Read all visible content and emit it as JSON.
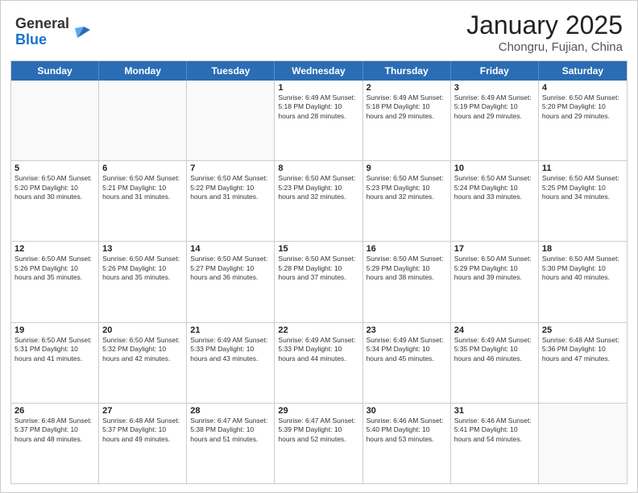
{
  "header": {
    "logo_line1": "General",
    "logo_line2": "Blue",
    "month": "January 2025",
    "location": "Chongru, Fujian, China"
  },
  "day_headers": [
    "Sunday",
    "Monday",
    "Tuesday",
    "Wednesday",
    "Thursday",
    "Friday",
    "Saturday"
  ],
  "weeks": [
    [
      {
        "day": "",
        "info": ""
      },
      {
        "day": "",
        "info": ""
      },
      {
        "day": "",
        "info": ""
      },
      {
        "day": "1",
        "info": "Sunrise: 6:49 AM\nSunset: 5:18 PM\nDaylight: 10 hours\nand 28 minutes."
      },
      {
        "day": "2",
        "info": "Sunrise: 6:49 AM\nSunset: 5:18 PM\nDaylight: 10 hours\nand 29 minutes."
      },
      {
        "day": "3",
        "info": "Sunrise: 6:49 AM\nSunset: 5:19 PM\nDaylight: 10 hours\nand 29 minutes."
      },
      {
        "day": "4",
        "info": "Sunrise: 6:50 AM\nSunset: 5:20 PM\nDaylight: 10 hours\nand 29 minutes."
      }
    ],
    [
      {
        "day": "5",
        "info": "Sunrise: 6:50 AM\nSunset: 5:20 PM\nDaylight: 10 hours\nand 30 minutes."
      },
      {
        "day": "6",
        "info": "Sunrise: 6:50 AM\nSunset: 5:21 PM\nDaylight: 10 hours\nand 31 minutes."
      },
      {
        "day": "7",
        "info": "Sunrise: 6:50 AM\nSunset: 5:22 PM\nDaylight: 10 hours\nand 31 minutes."
      },
      {
        "day": "8",
        "info": "Sunrise: 6:50 AM\nSunset: 5:23 PM\nDaylight: 10 hours\nand 32 minutes."
      },
      {
        "day": "9",
        "info": "Sunrise: 6:50 AM\nSunset: 5:23 PM\nDaylight: 10 hours\nand 32 minutes."
      },
      {
        "day": "10",
        "info": "Sunrise: 6:50 AM\nSunset: 5:24 PM\nDaylight: 10 hours\nand 33 minutes."
      },
      {
        "day": "11",
        "info": "Sunrise: 6:50 AM\nSunset: 5:25 PM\nDaylight: 10 hours\nand 34 minutes."
      }
    ],
    [
      {
        "day": "12",
        "info": "Sunrise: 6:50 AM\nSunset: 5:26 PM\nDaylight: 10 hours\nand 35 minutes."
      },
      {
        "day": "13",
        "info": "Sunrise: 6:50 AM\nSunset: 5:26 PM\nDaylight: 10 hours\nand 35 minutes."
      },
      {
        "day": "14",
        "info": "Sunrise: 6:50 AM\nSunset: 5:27 PM\nDaylight: 10 hours\nand 36 minutes."
      },
      {
        "day": "15",
        "info": "Sunrise: 6:50 AM\nSunset: 5:28 PM\nDaylight: 10 hours\nand 37 minutes."
      },
      {
        "day": "16",
        "info": "Sunrise: 6:50 AM\nSunset: 5:29 PM\nDaylight: 10 hours\nand 38 minutes."
      },
      {
        "day": "17",
        "info": "Sunrise: 6:50 AM\nSunset: 5:29 PM\nDaylight: 10 hours\nand 39 minutes."
      },
      {
        "day": "18",
        "info": "Sunrise: 6:50 AM\nSunset: 5:30 PM\nDaylight: 10 hours\nand 40 minutes."
      }
    ],
    [
      {
        "day": "19",
        "info": "Sunrise: 6:50 AM\nSunset: 5:31 PM\nDaylight: 10 hours\nand 41 minutes."
      },
      {
        "day": "20",
        "info": "Sunrise: 6:50 AM\nSunset: 5:32 PM\nDaylight: 10 hours\nand 42 minutes."
      },
      {
        "day": "21",
        "info": "Sunrise: 6:49 AM\nSunset: 5:33 PM\nDaylight: 10 hours\nand 43 minutes."
      },
      {
        "day": "22",
        "info": "Sunrise: 6:49 AM\nSunset: 5:33 PM\nDaylight: 10 hours\nand 44 minutes."
      },
      {
        "day": "23",
        "info": "Sunrise: 6:49 AM\nSunset: 5:34 PM\nDaylight: 10 hours\nand 45 minutes."
      },
      {
        "day": "24",
        "info": "Sunrise: 6:49 AM\nSunset: 5:35 PM\nDaylight: 10 hours\nand 46 minutes."
      },
      {
        "day": "25",
        "info": "Sunrise: 6:48 AM\nSunset: 5:36 PM\nDaylight: 10 hours\nand 47 minutes."
      }
    ],
    [
      {
        "day": "26",
        "info": "Sunrise: 6:48 AM\nSunset: 5:37 PM\nDaylight: 10 hours\nand 48 minutes."
      },
      {
        "day": "27",
        "info": "Sunrise: 6:48 AM\nSunset: 5:37 PM\nDaylight: 10 hours\nand 49 minutes."
      },
      {
        "day": "28",
        "info": "Sunrise: 6:47 AM\nSunset: 5:38 PM\nDaylight: 10 hours\nand 51 minutes."
      },
      {
        "day": "29",
        "info": "Sunrise: 6:47 AM\nSunset: 5:39 PM\nDaylight: 10 hours\nand 52 minutes."
      },
      {
        "day": "30",
        "info": "Sunrise: 6:46 AM\nSunset: 5:40 PM\nDaylight: 10 hours\nand 53 minutes."
      },
      {
        "day": "31",
        "info": "Sunrise: 6:46 AM\nSunset: 5:41 PM\nDaylight: 10 hours\nand 54 minutes."
      },
      {
        "day": "",
        "info": ""
      }
    ]
  ]
}
